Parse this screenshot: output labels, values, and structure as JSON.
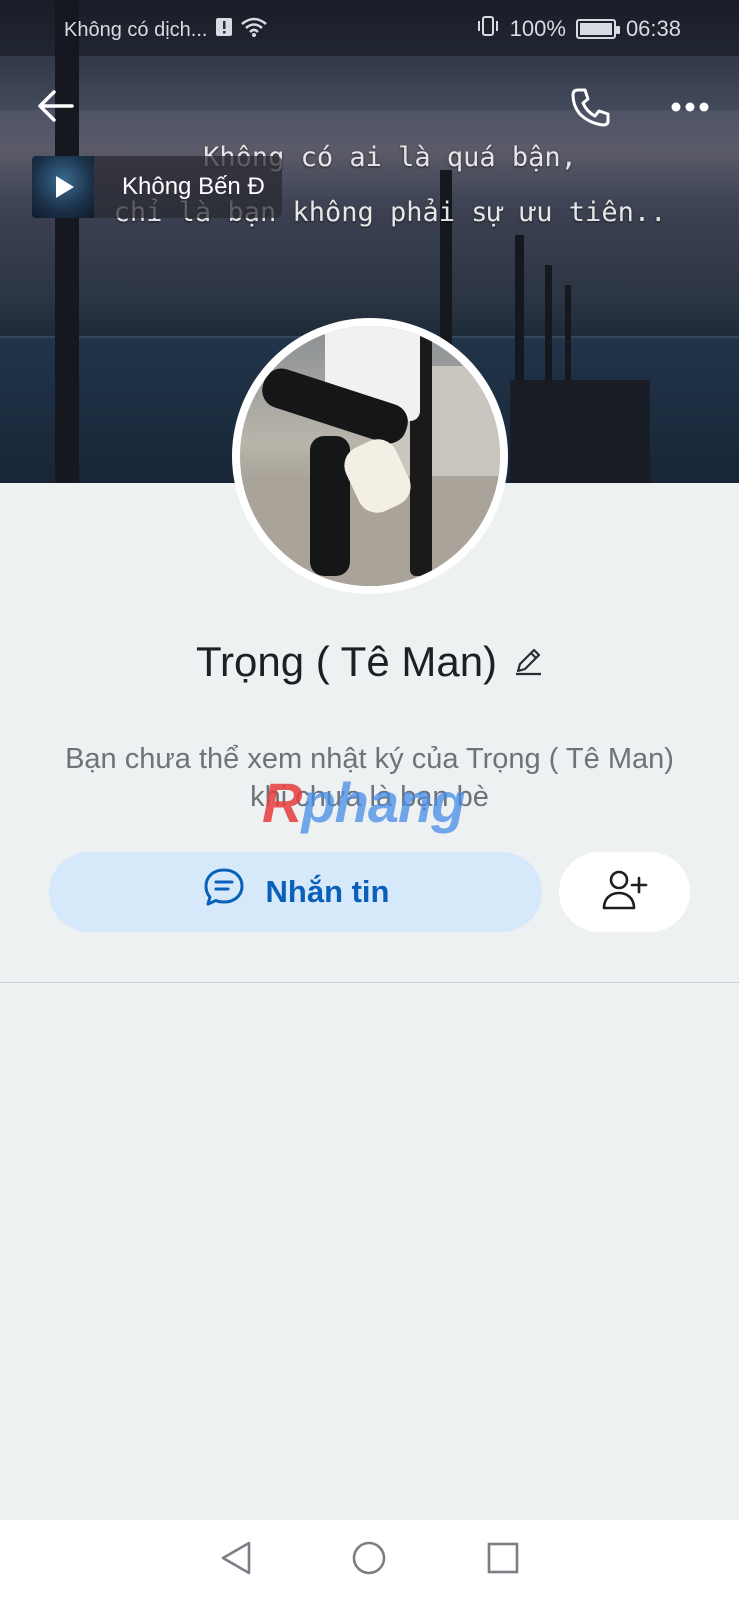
{
  "status_bar": {
    "carrier": "Không có dịch...",
    "battery": "100%",
    "time": "06:38"
  },
  "header": {
    "back_icon": "arrow-left-icon",
    "call_icon": "phone-icon",
    "more_icon": "more-horizontal-icon"
  },
  "cover": {
    "caption_line1": "Không có ai là quá bận,",
    "caption_line2": "chỉ là bạn không phải sự ưu tiên.."
  },
  "music": {
    "title": "Không Bến Đ"
  },
  "profile": {
    "name": "Trọng ( Tê Man)",
    "edit_icon": "pencil-icon",
    "diary_note": "Bạn chưa thể xem nhật ký của Trọng ( Tê Man) khi chưa là bạn bè"
  },
  "watermark": {
    "first": "R",
    "rest": "phang"
  },
  "actions": {
    "message_label": "Nhắn tin",
    "message_icon": "chat-bubble-icon",
    "add_friend_icon": "add-user-icon"
  },
  "colors": {
    "accent": "#0a5fb8",
    "message_bg": "#d6e9fb",
    "page_bg": "#eef1f2"
  },
  "nav": {
    "back_icon": "nav-back-icon",
    "home_icon": "nav-home-icon",
    "recents_icon": "nav-recents-icon"
  }
}
